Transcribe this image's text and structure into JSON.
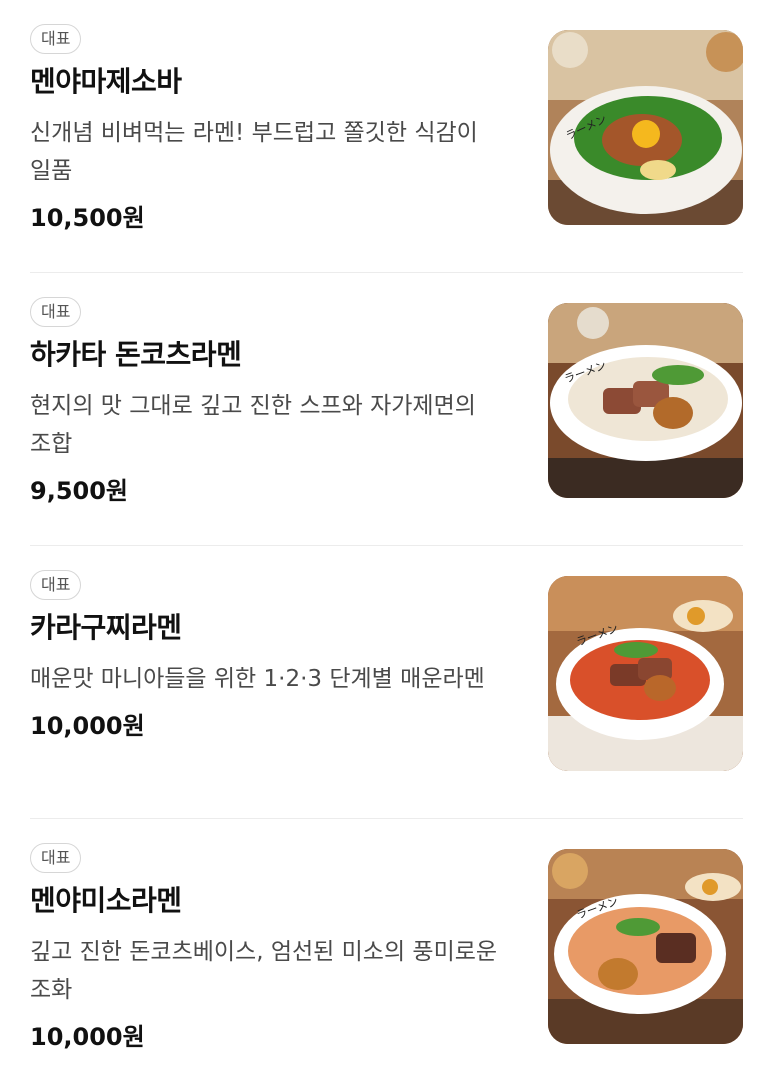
{
  "menu": {
    "items": [
      {
        "badge": "대표",
        "name": "멘야마제소바",
        "description": "신개념 비벼먹는 라멘! 부드럽고 쫄깃한 식감이 일품",
        "price": "10,500원",
        "image_icon": "mazesoba-bowl-photo"
      },
      {
        "badge": "대표",
        "name": "하카타 돈코츠라멘",
        "description": "현지의 맛 그대로 깊고 진한 스프와 자가제면의 조합",
        "price": "9,500원",
        "image_icon": "tonkotsu-ramen-photo"
      },
      {
        "badge": "대표",
        "name": "카라구찌라멘",
        "description": "매운맛 마니아들을 위한 1·2·3 단계별 매운라멘",
        "price": "10,000원",
        "image_icon": "spicy-ramen-photo"
      },
      {
        "badge": "대표",
        "name": "멘야미소라멘",
        "description": "깊고 진한 돈코츠베이스, 엄선된 미소의 풍미로운 조화",
        "price": "10,000원",
        "image_icon": "miso-ramen-photo"
      }
    ]
  },
  "bowl_lettering": "ラーメン"
}
